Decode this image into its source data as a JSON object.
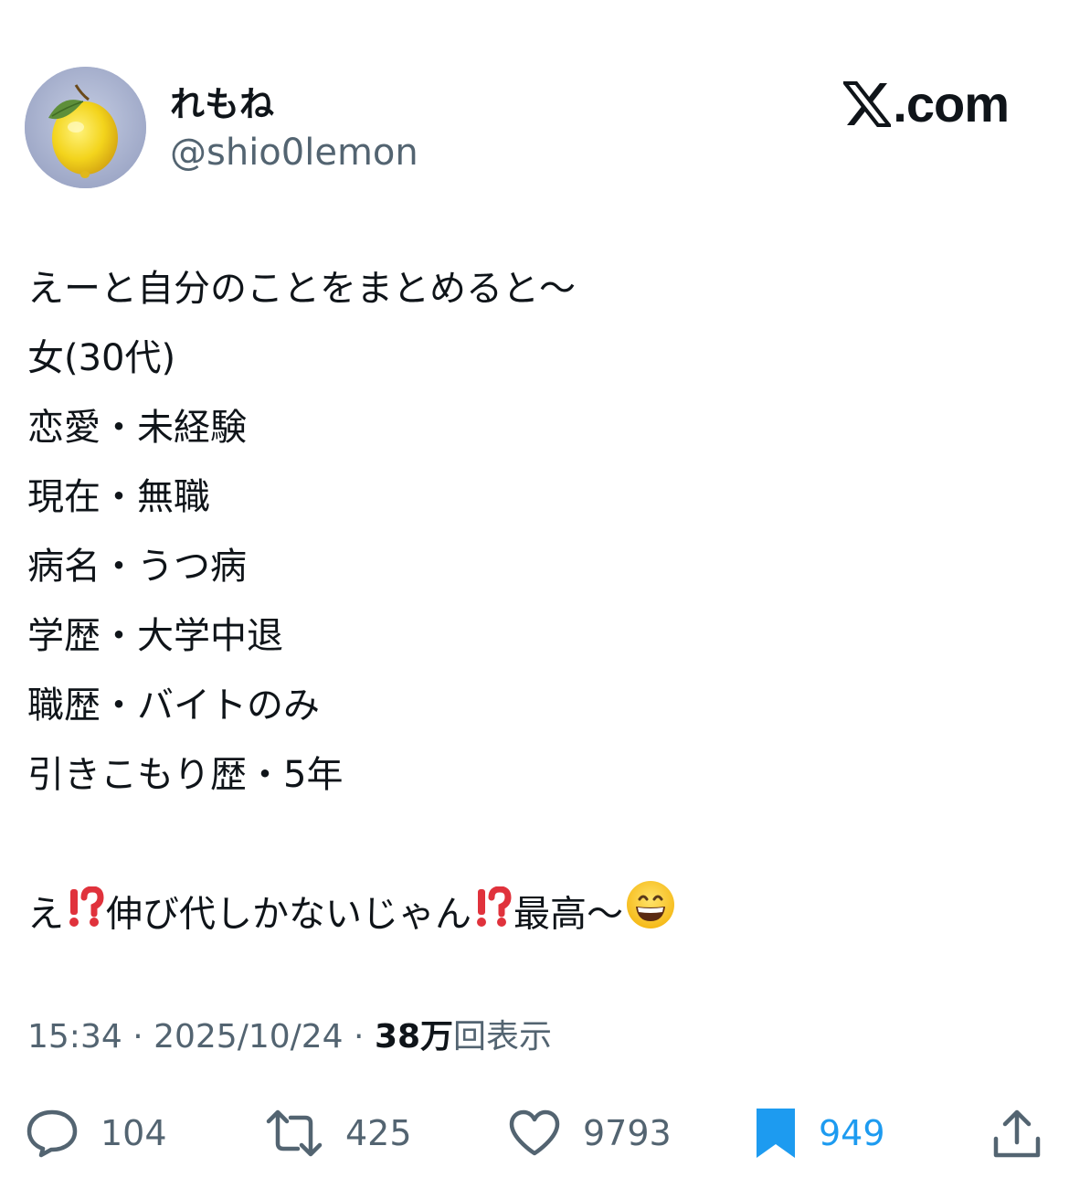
{
  "author": {
    "display_name": "れもね",
    "handle": "@shio0lemon",
    "avatar": "lemon-avatar"
  },
  "brand": {
    "name": "X.com",
    "suffix": ".com"
  },
  "tweet": {
    "lines": [
      "えーと自分のことをまとめると〜",
      "女(30代)",
      "恋愛・未経験",
      "現在・無職",
      "病名・うつ病",
      "学歴・大学中退",
      "職歴・バイトのみ",
      "引きこもり歴・5年"
    ],
    "last_line": {
      "part1": "え",
      "part2": "伸び代しかないじゃん",
      "part3": "最高〜",
      "emoji_1": "⁉️",
      "emoji_2": "⁉️",
      "emoji_3": "😄"
    }
  },
  "meta": {
    "time": "15:34",
    "separator": " · ",
    "date": "2025/10/24",
    "views_count": "38万",
    "views_label": "回表示"
  },
  "actions": {
    "replies": "104",
    "reposts": "425",
    "likes": "9793",
    "bookmarks": "949",
    "icons": [
      "reply-icon",
      "repost-icon",
      "like-icon",
      "bookmark-icon",
      "share-icon"
    ]
  },
  "colors": {
    "text": "#0f1419",
    "secondary": "#536471",
    "accent": "#1d9bf0",
    "interrobang": "#e0323c"
  }
}
